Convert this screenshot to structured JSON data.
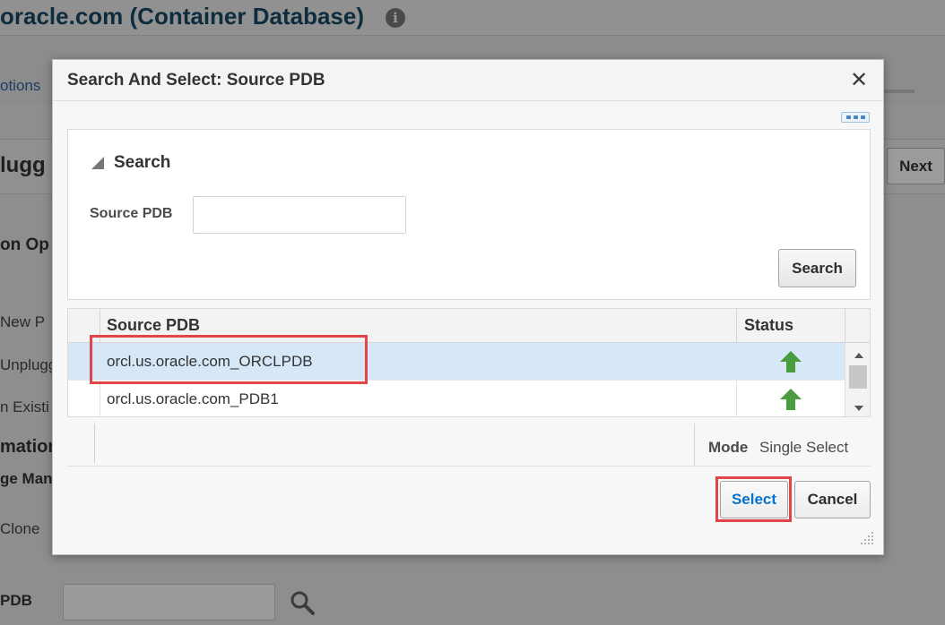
{
  "background": {
    "title": "oracle.com (Container Database)",
    "tab_fragment": "otions",
    "heading_fragment": "lugg",
    "next_label": "Next",
    "section_fragment": "on Op",
    "options": [
      "New P",
      "Unplugg",
      "n Existi"
    ],
    "info_fragment": "mation",
    "storage_fragment": "ge Man",
    "clone_fragment": "Clone",
    "pdb_label": "PDB"
  },
  "dialog": {
    "title": "Search And Select: Source PDB",
    "close_label": "✕",
    "search_heading": "Search",
    "source_pdb_label": "Source PDB",
    "source_pdb_value": "",
    "search_button": "Search",
    "table": {
      "columns": [
        "Source PDB",
        "Status"
      ],
      "rows": [
        {
          "source_pdb": "orcl.us.oracle.com_ORCLPDB",
          "status": "up",
          "selected": true
        },
        {
          "source_pdb": "orcl.us.oracle.com_PDB1",
          "status": "up",
          "selected": false
        }
      ]
    },
    "mode_label": "Mode",
    "mode_value": "Single Select",
    "select_button": "Select",
    "cancel_button": "Cancel"
  },
  "colors": {
    "accent": "#0572ce",
    "selected_row": "#d6e8f8",
    "status_up": "#4a9d3f",
    "highlight": "#e0454a"
  }
}
